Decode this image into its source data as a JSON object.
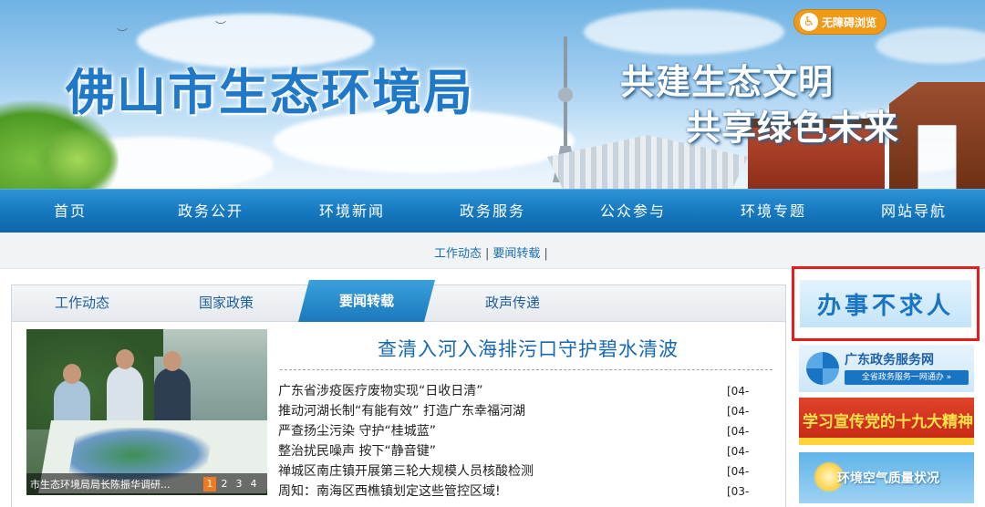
{
  "header": {
    "site_title": "佛山市生态环境局",
    "slogan_line1": "共建生态文明",
    "slogan_line2": "共享绿色未来",
    "accessibility_label": "无障碍浏览",
    "accessibility_icon": "wheelchair-icon"
  },
  "nav": {
    "items": [
      {
        "label": "首页"
      },
      {
        "label": "政务公开"
      },
      {
        "label": "环境新闻"
      },
      {
        "label": "政务服务"
      },
      {
        "label": "公众参与"
      },
      {
        "label": "环境专题"
      },
      {
        "label": "网站导航"
      }
    ]
  },
  "sub_links": [
    "工作动态",
    "要闻转载"
  ],
  "tabs": [
    {
      "label": "工作动态",
      "active": false
    },
    {
      "label": "国家政策",
      "active": false
    },
    {
      "label": "要闻转载",
      "active": true
    },
    {
      "label": "政声传递",
      "active": false
    }
  ],
  "slideshow": {
    "caption": "市生态环境局局长陈振华调研...",
    "pages": [
      "1",
      "2",
      "3",
      "4"
    ],
    "active_page": "1"
  },
  "headline": "查清入河入海排污口守护碧水清波",
  "news": [
    {
      "title": "广东省涉疫医疗废物实现“日收日清”",
      "date": "[04-"
    },
    {
      "title": "推动河湖长制“有能有效” 打造广东幸福河湖",
      "date": "[04-"
    },
    {
      "title": "严查扬尘污染 守护“桂城蓝”",
      "date": "[04-"
    },
    {
      "title": "整治扰民噪声 按下“静音键”",
      "date": "[04-"
    },
    {
      "title": "禅城区南庄镇开展第三轮大规模人员核酸检测",
      "date": "[04-"
    },
    {
      "title": "周知：南海区西樵镇划定这些管控区域!",
      "date": "[03-"
    }
  ],
  "sidebar": {
    "banban_label": "办事不求人",
    "gov_service_title": "广东政务服务网",
    "gov_service_sub": "全省政务服务一网通办 »",
    "propaganda_label": "学习宣传党的十九大精神",
    "air_quality_label": "环境空气质量状况"
  },
  "colors": {
    "nav_blue": "#1577bd",
    "link_blue": "#1a6fb5",
    "highlight_red": "#e31c1c",
    "accessibility_orange": "#f09a1a",
    "pager_active": "#f07a1d"
  }
}
